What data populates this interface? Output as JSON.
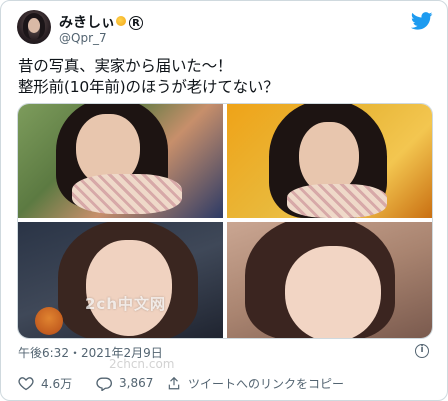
{
  "user": {
    "display_name": "みきしぃ",
    "handle": "@Qpr_7"
  },
  "tweet": {
    "line1": "昔の写真、実家から届いた〜！",
    "line2": "整形前(10年前)のほうが老けてない？"
  },
  "icons": {
    "avatar": "user-avatar",
    "brand": "twitter-bird-icon",
    "name_emoji": "sun-emoji-icon",
    "badge": "registered-mark-icon",
    "info": "info-icon",
    "like": "heart-icon",
    "reply": "reply-bubble-icon",
    "share": "share-link-icon"
  },
  "colors": {
    "brand": "#1d9bf0",
    "secondary_text": "#536471",
    "border": "#cfd9de"
  },
  "overlay": {
    "watermark": "2ch中文网",
    "watermark_url": "2chcn.com"
  },
  "meta": {
    "timestamp": "午後6:32・2021年2月9日",
    "reg_mark": "R",
    "info_mark": "i"
  },
  "actions": {
    "likes": "4.6万",
    "replies": "3,867",
    "copy_link": "ツイートへのリンクをコピー"
  }
}
